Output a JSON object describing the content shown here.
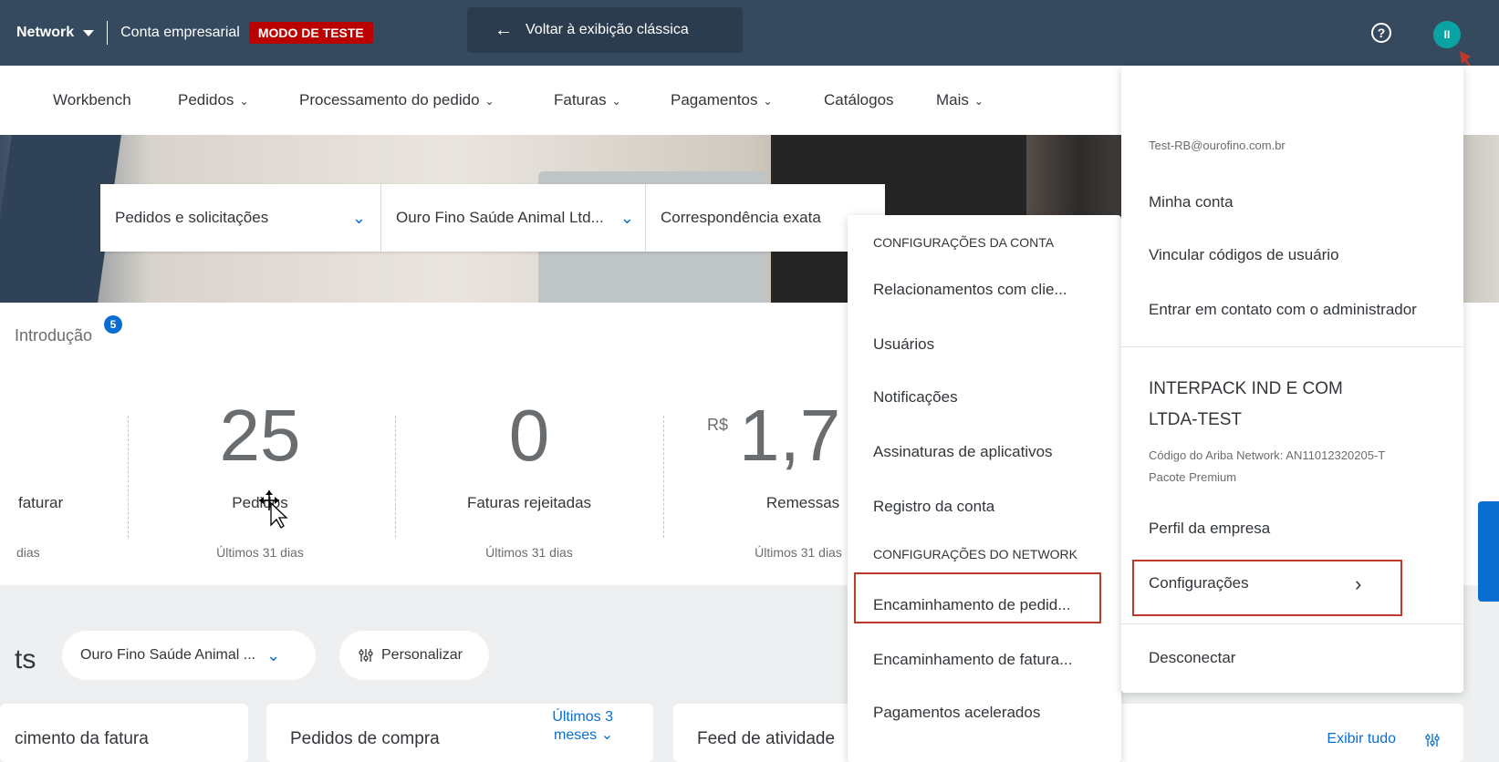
{
  "topbar": {
    "brand": "Network",
    "account": "Conta empresarial",
    "test_mode": "MODO DE TESTE",
    "classic_view": "Voltar à exibição clássica",
    "help": "?",
    "avatar_initials": "II"
  },
  "nav": {
    "items": [
      {
        "label": "Workbench",
        "chevron": false
      },
      {
        "label": "Pedidos",
        "chevron": true
      },
      {
        "label": "Processamento do pedido",
        "chevron": true
      },
      {
        "label": "Faturas",
        "chevron": true
      },
      {
        "label": "Pagamentos",
        "chevron": true
      },
      {
        "label": "Catálogos",
        "chevron": false
      },
      {
        "label": "Mais",
        "chevron": true
      }
    ]
  },
  "search": {
    "type": "Pedidos e solicitações",
    "customer": "Ouro Fino Saúde Animal Ltd...",
    "match": "Correspondência exata"
  },
  "intro": {
    "label": "Introdução",
    "badge": "5"
  },
  "metrics": [
    {
      "value": "",
      "label": "faturar",
      "sub": "dias"
    },
    {
      "value": "25",
      "label": "Pedidos",
      "sub": "Últimos 31 dias"
    },
    {
      "value": "0",
      "label": "Faturas rejeitadas",
      "sub": "Últimos 31 dias"
    },
    {
      "currency": "R$",
      "value": "1,7",
      "suffix": "",
      "label": "Remessas",
      "sub": "Últimos 31 dias"
    }
  ],
  "lower": {
    "title_fragment": "ts",
    "customer_chip": "Ouro Fino Saúde Animal ...",
    "customize": "Personalizar",
    "cards": {
      "invoice_title": "cimento da fatura",
      "po_title": "Pedidos de compra",
      "po_range_line1": "Últimos 3",
      "po_range_line2": "meses",
      "feed_title": "Feed de atividade",
      "view_all": "Exibir tudo"
    }
  },
  "settings_menu": {
    "account_header": "CONFIGURAÇÕES DA CONTA",
    "account_items": [
      "Relacionamentos com clie...",
      "Usuários",
      "Notificações",
      "Assinaturas de aplicativos",
      "Registro da conta"
    ],
    "network_header": "CONFIGURAÇÕES DO NETWORK",
    "network_items": [
      "Encaminhamento de pedid...",
      "Encaminhamento de fatura...",
      "Pagamentos acelerados"
    ]
  },
  "user_menu": {
    "email": "Test-RB@ourofino.com.br",
    "my_account": "Minha conta",
    "link_user_codes": "Vincular códigos de usuário",
    "contact_admin": "Entrar em contato com o administrador",
    "company_line1": "INTERPACK IND E COM",
    "company_line2": "LTDA-TEST",
    "network_id": "Código do Ariba Network: AN11012320205-T",
    "package": "Pacote Premium",
    "company_profile": "Perfil da empresa",
    "settings": "Configurações",
    "logout": "Desconectar"
  },
  "colors": {
    "topbar": "#354a5f",
    "accent": "#0a6ed1",
    "test_badge": "#bb0000",
    "highlight": "#c0392b",
    "avatar": "#0aa3a3"
  }
}
